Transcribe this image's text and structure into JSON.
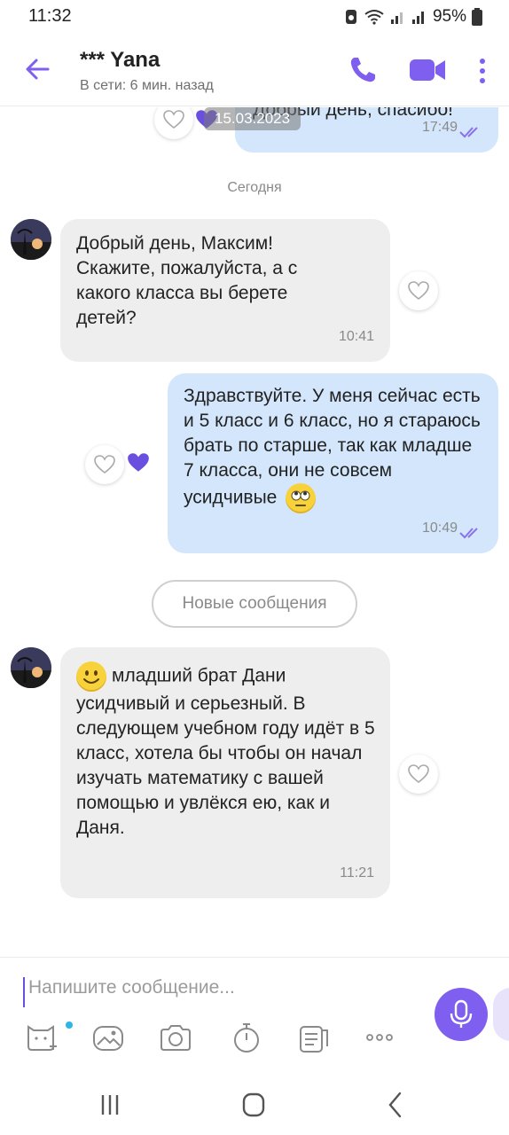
{
  "status_bar": {
    "time": "11:32",
    "battery": "95%"
  },
  "header": {
    "name": "*** Yana",
    "status": "В сети: 6 мин. назад"
  },
  "chat": {
    "top_message": {
      "text": "Добрый день, спасибо!",
      "time": "17:49"
    },
    "date_chip": "15.03.2023",
    "today_label": "Сегодня",
    "messages": [
      {
        "text": "Добрый день, Максим! Скажите, пожалуйста,  а с какого класса вы берете детей?",
        "time": "10:41"
      },
      {
        "text": "Здравствуйте. У меня сейчас есть и 5 класс и 6 класс, но я стараюсь брать по старше, так как младше 7 класса, они не совсем усидчивые",
        "time": "10:49"
      },
      {
        "text": "младший брат Дани усидчивый и серьезный. В следующем учебном году идёт в 5 класс, хотела бы чтобы он начал изучать математику с вашей помощью и увлёкся ею, как и Даня.",
        "time": "11:21"
      }
    ],
    "new_messages_label": "Новые сообщения"
  },
  "composer": {
    "placeholder": "Напишите сообщение..."
  },
  "colors": {
    "accent": "#7f5ff0",
    "outgoing": "#d3e6fb",
    "incoming": "#eeeeee"
  }
}
